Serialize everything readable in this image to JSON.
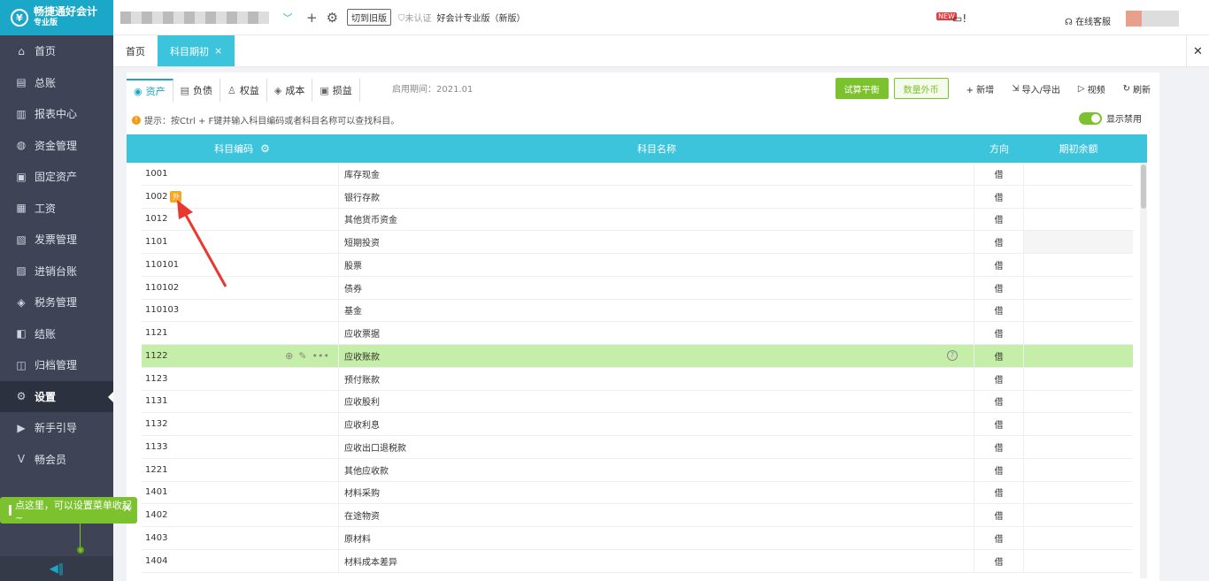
{
  "sidebar": {
    "logo_text": "畅捷通好会计",
    "logo_sub": "专业版",
    "items": [
      {
        "label": "首页",
        "icon": "home-icon",
        "glyph": "⌂"
      },
      {
        "label": "总账",
        "icon": "ledger-icon",
        "glyph": "▤"
      },
      {
        "label": "报表中心",
        "icon": "chart-icon",
        "glyph": "▥"
      },
      {
        "label": "资金管理",
        "icon": "money-bag-icon",
        "glyph": "◍"
      },
      {
        "label": "固定资产",
        "icon": "building-icon",
        "glyph": "▣"
      },
      {
        "label": "工资",
        "icon": "salary-icon",
        "glyph": "▦"
      },
      {
        "label": "发票管理",
        "icon": "invoice-icon",
        "glyph": "▧"
      },
      {
        "label": "进销台账",
        "icon": "inventory-icon",
        "glyph": "▨"
      },
      {
        "label": "税务管理",
        "icon": "tax-icon",
        "glyph": "◈"
      },
      {
        "label": "结账",
        "icon": "checkout-icon",
        "glyph": "◧"
      },
      {
        "label": "归档管理",
        "icon": "archive-icon",
        "glyph": "◫"
      },
      {
        "label": "设置",
        "icon": "gear-icon",
        "glyph": "⚙"
      },
      {
        "label": "新手引导",
        "icon": "play-icon",
        "glyph": "▶"
      },
      {
        "label": "畅会员",
        "icon": "vip-icon",
        "glyph": "V"
      }
    ],
    "active_index": 11,
    "collapse_glyph": "◀‖"
  },
  "toast": {
    "text": "点这里，可以设置菜单收起~",
    "close": "✕"
  },
  "topbar": {
    "dropdown_glyph": "﹀",
    "add_glyph": "+",
    "settings_glyph": "⚙",
    "switch_label": "切到旧版",
    "cert_label": "未认证",
    "edition_label": "好会计专业版（新版）",
    "new_badge": "NEW",
    "notify_text": "!",
    "service_label": "在线客服"
  },
  "tabs": [
    {
      "label": "首页",
      "active": false
    },
    {
      "label": "科目期初",
      "active": true,
      "close": "×"
    }
  ],
  "tabbar_close": "✕",
  "subtabs": [
    {
      "label": "资产",
      "icon": "asset-icon",
      "glyph": "◉"
    },
    {
      "label": "负债",
      "icon": "liability-icon",
      "glyph": "▤"
    },
    {
      "label": "权益",
      "icon": "equity-icon",
      "glyph": "♙"
    },
    {
      "label": "成本",
      "icon": "cost-icon",
      "glyph": "◈"
    },
    {
      "label": "损益",
      "icon": "profit-loss-icon",
      "glyph": "▣"
    }
  ],
  "start_period": "启用期间：2021.01",
  "toolbar": {
    "trial_balance": "试算平衡",
    "qty_foreign": "数量外币",
    "add": "+ 新增",
    "import_export": "导入/导出",
    "video": "视频",
    "refresh": "刷新"
  },
  "hint": {
    "icon_glyph": "!",
    "text": "提示：按Ctrl + F键并输入科目编码或者科目名称可以查找科目。"
  },
  "toggle_label": "显示禁用",
  "table": {
    "headers": {
      "code": "科目编码",
      "name": "科目名称",
      "direction": "方向",
      "balance": "期初余额"
    },
    "foreign_badge": "外",
    "rows": [
      {
        "code": "1001",
        "name": "库存现金",
        "dir": "借"
      },
      {
        "code": "1002",
        "name": "银行存款",
        "dir": "借",
        "foreign": true
      },
      {
        "code": "1012",
        "name": "其他货币资金",
        "dir": "借"
      },
      {
        "code": "1101",
        "name": "短期投资",
        "dir": "借",
        "grey": true
      },
      {
        "code": "110101",
        "name": "股票",
        "dir": "借"
      },
      {
        "code": "110102",
        "name": "债券",
        "dir": "借"
      },
      {
        "code": "110103",
        "name": "基金",
        "dir": "借"
      },
      {
        "code": "1121",
        "name": "应收票据",
        "dir": "借"
      },
      {
        "code": "1122",
        "name": "应收账款",
        "dir": "借",
        "highlight": true
      },
      {
        "code": "1123",
        "name": "预付账款",
        "dir": "借"
      },
      {
        "code": "1131",
        "name": "应收股利",
        "dir": "借"
      },
      {
        "code": "1132",
        "name": "应收利息",
        "dir": "借"
      },
      {
        "code": "1133",
        "name": "应收出口退税款",
        "dir": "借"
      },
      {
        "code": "1221",
        "name": "其他应收款",
        "dir": "借"
      },
      {
        "code": "1401",
        "name": "材料采购",
        "dir": "借"
      },
      {
        "code": "1402",
        "name": "在途物资",
        "dir": "借"
      },
      {
        "code": "1403",
        "name": "原材料",
        "dir": "借"
      },
      {
        "code": "1404",
        "name": "材料成本差异",
        "dir": "借"
      }
    ]
  },
  "colors": {
    "brand": "#1aa7c8",
    "header": "#3cc4dc",
    "accent_green": "#7cc22e",
    "highlight_row": "#c5efa8",
    "arrow": "#e8382f"
  }
}
